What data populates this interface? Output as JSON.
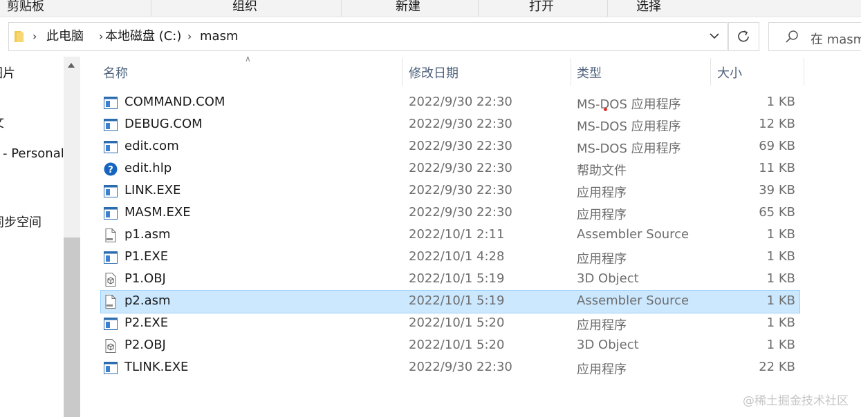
{
  "ribbon": {
    "groups": [
      "剪贴板",
      "组织",
      "新建",
      "打开",
      "选择"
    ]
  },
  "address": {
    "crumbs": [
      "此电脑",
      "本地磁盘 (C:)",
      "masm"
    ]
  },
  "search": {
    "placeholder": "在 masm"
  },
  "nav": {
    "items": [
      "图片",
      "文",
      "- Personal",
      "同步空间"
    ]
  },
  "columns": {
    "name": "名称",
    "date": "修改日期",
    "type": "类型",
    "size": "大小"
  },
  "files": [
    {
      "name": "COMMAND.COM",
      "date": "2022/9/30 22:30",
      "type": "MS-DOS 应用程序",
      "size": "1 KB",
      "icon": "exe-icon"
    },
    {
      "name": "DEBUG.COM",
      "date": "2022/9/30 22:30",
      "type": "MS-DOS 应用程序",
      "size": "12 KB",
      "icon": "exe-icon"
    },
    {
      "name": "edit.com",
      "date": "2022/9/30 22:30",
      "type": "MS-DOS 应用程序",
      "size": "69 KB",
      "icon": "exe-icon"
    },
    {
      "name": "edit.hlp",
      "date": "2022/9/30 22:30",
      "type": "帮助文件",
      "size": "11 KB",
      "icon": "help-icon"
    },
    {
      "name": "LINK.EXE",
      "date": "2022/9/30 22:30",
      "type": "应用程序",
      "size": "39 KB",
      "icon": "exe-icon"
    },
    {
      "name": "MASM.EXE",
      "date": "2022/9/30 22:30",
      "type": "应用程序",
      "size": "65 KB",
      "icon": "exe-icon"
    },
    {
      "name": "p1.asm",
      "date": "2022/10/1 2:11",
      "type": "Assembler Source",
      "size": "1 KB",
      "icon": "asm-file-icon"
    },
    {
      "name": "P1.EXE",
      "date": "2022/10/1 4:28",
      "type": "应用程序",
      "size": "1 KB",
      "icon": "exe-icon"
    },
    {
      "name": "P1.OBJ",
      "date": "2022/10/1 5:19",
      "type": "3D Object",
      "size": "1 KB",
      "icon": "3d-object-icon"
    },
    {
      "name": "p2.asm",
      "date": "2022/10/1 5:19",
      "type": "Assembler Source",
      "size": "1 KB",
      "icon": "asm-file-icon",
      "selected": true
    },
    {
      "name": "P2.EXE",
      "date": "2022/10/1 5:20",
      "type": "应用程序",
      "size": "1 KB",
      "icon": "exe-icon"
    },
    {
      "name": "P2.OBJ",
      "date": "2022/10/1 5:20",
      "type": "3D Object",
      "size": "1 KB",
      "icon": "3d-object-icon"
    },
    {
      "name": "TLINK.EXE",
      "date": "2022/9/30 22:30",
      "type": "应用程序",
      "size": "22 KB",
      "icon": "exe-icon"
    }
  ],
  "watermark": "@稀土掘金技术社区",
  "colors": {
    "selection": "#cce8ff",
    "header_text": "#4c607a",
    "secondary_text": "#6d6d6d"
  }
}
